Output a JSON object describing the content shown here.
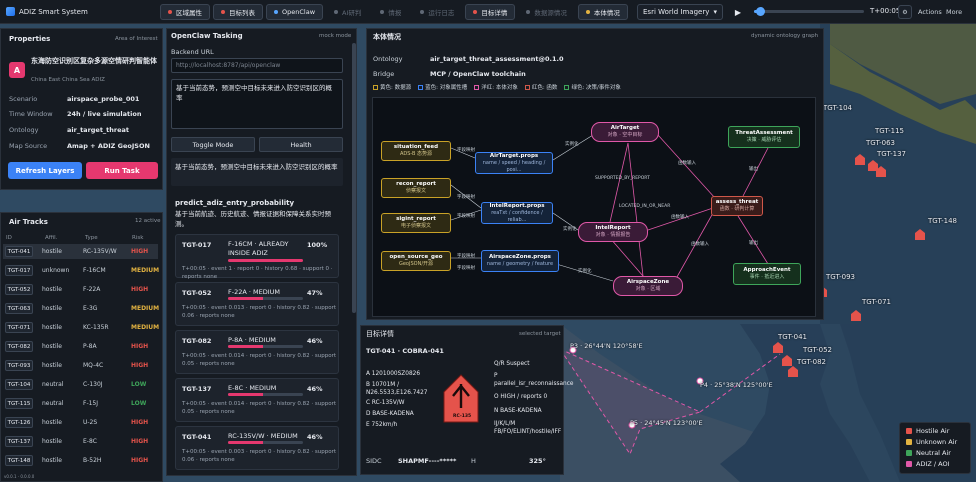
{
  "app": {
    "title": "ADIZ Smart System"
  },
  "tabs": [
    {
      "label": "区域属性",
      "dot": "#e5534b",
      "state": "on"
    },
    {
      "label": "目标列表",
      "dot": "#e5534b",
      "state": "on"
    },
    {
      "label": "OpenClaw",
      "dot": "#58a6ff",
      "state": "on"
    },
    {
      "label": "AI研判",
      "dot": "#5f6875",
      "state": "dim"
    },
    {
      "label": "情报",
      "dot": "#5f6875",
      "state": "dim"
    },
    {
      "label": "运行日志",
      "dot": "#5f6875",
      "state": "dim"
    },
    {
      "label": "目标详情",
      "dot": "#e5534b",
      "state": "on"
    },
    {
      "label": "数据源情况",
      "dot": "#5f6875",
      "state": "dim"
    },
    {
      "label": "本体情况",
      "dot": "#e3b341",
      "state": "on"
    }
  ],
  "toolbar": {
    "basemap": "Esri World Imagery",
    "time": "T+00:05",
    "btn1": "⚙",
    "btn2": "⚙",
    "actions": "Actions",
    "more": "More",
    "time_progress": 0.05
  },
  "properties": {
    "title": "Properties",
    "subtitle": "Area of Interest",
    "avatar": "A",
    "area_name": "东海防空识别区复杂多源空情研判智能体",
    "area_en": "China East China Sea ADIZ",
    "rows": [
      {
        "k": "Scenario",
        "v": "airspace_probe_001"
      },
      {
        "k": "Time Window",
        "v": "24h / live simulation"
      },
      {
        "k": "Ontology",
        "v": "air_target_threat"
      },
      {
        "k": "Map Source",
        "v": "Amap + ADIZ GeoJSON"
      }
    ],
    "refresh": "Refresh Layers",
    "run": "Run Task"
  },
  "tracks": {
    "title": "Air Tracks",
    "count": "12 active",
    "headers": [
      "ID",
      "Affil.",
      "Type",
      "Risk"
    ],
    "rows": [
      {
        "id": "TGT-041",
        "affil": "hostile",
        "type": "RC-135V/W",
        "risk": "HIGH"
      },
      {
        "id": "TGT-017",
        "affil": "unknown",
        "type": "F-16CM",
        "risk": "MEDIUM"
      },
      {
        "id": "TGT-052",
        "affil": "hostile",
        "type": "F-22A",
        "risk": "HIGH"
      },
      {
        "id": "TGT-063",
        "affil": "hostile",
        "type": "E-3G",
        "risk": "MEDIUM"
      },
      {
        "id": "TGT-071",
        "affil": "hostile",
        "type": "KC-135R",
        "risk": "MEDIUM"
      },
      {
        "id": "TGT-082",
        "affil": "hostile",
        "type": "P-8A",
        "risk": "HIGH"
      },
      {
        "id": "TGT-093",
        "affil": "hostile",
        "type": "MQ-4C",
        "risk": "HIGH"
      },
      {
        "id": "TGT-104",
        "affil": "neutral",
        "type": "C-130J",
        "risk": "LOW"
      },
      {
        "id": "TGT-115",
        "affil": "neutral",
        "type": "F-15J",
        "risk": "LOW"
      },
      {
        "id": "TGT-126",
        "affil": "hostile",
        "type": "U-2S",
        "risk": "HIGH"
      },
      {
        "id": "TGT-137",
        "affil": "hostile",
        "type": "E-8C",
        "risk": "HIGH"
      },
      {
        "id": "TGT-148",
        "affil": "hostile",
        "type": "B-52H",
        "risk": "HIGH"
      }
    ]
  },
  "openclaw": {
    "title": "OpenClaw Tasking",
    "mode": "mock mode",
    "backend_label": "Backend URL",
    "backend_url": "http://localhost:8787/api/openclaw",
    "prompt": "基于当前态势，预测空中目标未来进入防空识别区的概率",
    "toggle": "Toggle Mode",
    "health": "Health",
    "echo": "基于当前态势，预测空中目标未来进入防空识别区的概率",
    "task_title": "predict_adiz_entry_probability",
    "task_desc": "基于当前航迹、历史航迹、情报证据和保障关系实时预测。",
    "preds": [
      {
        "id": "TGT-017",
        "desc": "F-16CM · ALREADY INSIDE ADIZ",
        "pct": "100%",
        "value": 1.0,
        "meta": "T+00:05 · event 1 · report 0 · history 0.68 · support 0 · reports none"
      },
      {
        "id": "TGT-052",
        "desc": "F-22A · MEDIUM",
        "pct": "47%",
        "value": 0.47,
        "meta": "T+00:05 · event 0.013 · report 0 · history 0.82 · support 0.06 · reports none"
      },
      {
        "id": "TGT-082",
        "desc": "P-8A · MEDIUM",
        "pct": "46%",
        "value": 0.46,
        "meta": "T+00:05 · event 0.014 · report 0 · history 0.82 · support 0.05 · reports none"
      },
      {
        "id": "TGT-137",
        "desc": "E-8C · MEDIUM",
        "pct": "46%",
        "value": 0.46,
        "meta": "T+00:05 · event 0.014 · report 0 · history 0.82 · support 0.05 · reports none"
      },
      {
        "id": "TGT-041",
        "desc": "RC-135V/W · MEDIUM",
        "pct": "46%",
        "value": 0.46,
        "meta": "T+00:05 · event 0.003 · report 0 · history 0.82 · support 0.06 · reports none"
      }
    ]
  },
  "ontology": {
    "title": "本体情况",
    "badge": "dynamic ontology graph",
    "ontology_label": "Ontology",
    "ontology_value": "air_target_threat_assessment@0.1.0",
    "bridge_label": "Bridge",
    "bridge_value": "MCP / OpenClaw toolchain",
    "legend": [
      {
        "label": "黄色: 数据源",
        "color": "#c9a227"
      },
      {
        "label": "蓝色: 对象属性槽",
        "color": "#3b82f6"
      },
      {
        "label": "洋红: 本体对象",
        "color": "#e058a8"
      },
      {
        "label": "红色: 函数",
        "color": "#d0584a"
      },
      {
        "label": "绿色: 决策/事件对象",
        "color": "#3ea55a"
      }
    ],
    "nodes": [
      {
        "id": "situation_feed",
        "sub": "ADS-B 态势源",
        "cls": "y"
      },
      {
        "id": "recon_report",
        "sub": "侦察报文",
        "cls": "y"
      },
      {
        "id": "sigint_report",
        "sub": "电子侦察报文",
        "cls": "y"
      },
      {
        "id": "open_source_geo",
        "sub": "GeoJSON/开源",
        "cls": "y"
      },
      {
        "id": "AirTarget.props",
        "sub": "name / speed / heading / posi...",
        "cls": "b"
      },
      {
        "id": "IntelReport.props",
        "sub": "reaTxt / confidence / reliab...",
        "cls": "b"
      },
      {
        "id": "AirspaceZone.props",
        "sub": "name / geometry / feature",
        "cls": "b"
      },
      {
        "id": "AirTarget",
        "sub": "对象 · 空中目标",
        "cls": "p"
      },
      {
        "id": "IntelReport",
        "sub": "对象 · 情报报告",
        "cls": "p"
      },
      {
        "id": "AirspaceZone",
        "sub": "对象 · 区域",
        "cls": "p"
      },
      {
        "id": "assess_threat",
        "sub": "函数 · 研判计算",
        "cls": "r"
      },
      {
        "id": "ThreatAssessment",
        "sub": "决策 · 威胁评估",
        "cls": "g"
      },
      {
        "id": "ApproachEvent",
        "sub": "事件 · 抵近进入",
        "cls": "g"
      }
    ],
    "edges": [
      "实例化",
      "字段映射",
      "字段映射",
      "字段映射",
      "字段映射",
      "SUPPORTED_BY_REPORT",
      "LOCATED_IN_OR_NEAR",
      "函数输入",
      "函数输入",
      "函数输入",
      "实例化",
      "实例化",
      "输出",
      "输出",
      "字段映射"
    ]
  },
  "target": {
    "title": "目标详情",
    "badge": "selected target",
    "header": "TGT-041 · COBRA-041",
    "left": [
      "A   1201000SZ0826",
      "B   10701M / N26.5533,E126.7427",
      "C   RC-135V/W",
      "D   BASE-KADENA",
      "E   752km/h"
    ],
    "right": [
      "Q/R  Suspect",
      "P   parallel_isr_reconnaissance",
      "O   HIGH / reports 0",
      "N   BASE-KADENA",
      "IJ/K/L/M  FB/FO/ELINT/hostile/IFF"
    ],
    "symbol_label": "RC-135",
    "sidc_label": "SIDC",
    "sidc": "SHAPMF----*****",
    "h_label": "H",
    "h": "325°"
  },
  "map": {
    "labels": [
      "TGT-104",
      "TGT-115",
      "TGT-063",
      "TGT-137",
      "TGT-148",
      "TGT-093",
      "TGT-071",
      "TGT-041",
      "TGT-052",
      "TGT-082"
    ],
    "points": [
      "P3 · 26°44'N 120°58'E",
      "P4 · 25°38'N 125°00'E",
      "P5 · 24°45'N 123°00'E"
    ],
    "legend": [
      {
        "label": "Hostile Air",
        "color": "#e5534b"
      },
      {
        "label": "Unknown Air",
        "color": "#e3b341"
      },
      {
        "label": "Neutral Air",
        "color": "#3ea55a"
      },
      {
        "label": "ADIZ / AOI",
        "color": "#e058a8"
      }
    ],
    "footer": "v0.0.1 · 0.0.0.0"
  }
}
